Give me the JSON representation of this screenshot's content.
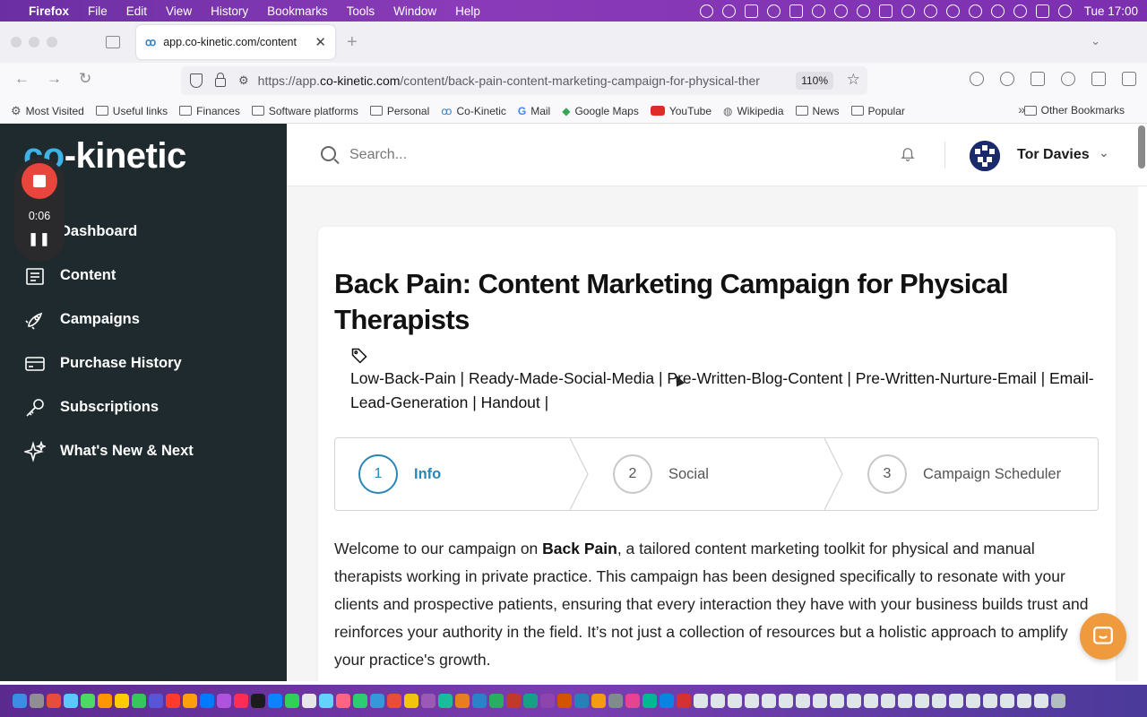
{
  "menubar": {
    "app_name": "Firefox",
    "items": [
      "File",
      "Edit",
      "View",
      "History",
      "Bookmarks",
      "Tools",
      "Window",
      "Help"
    ],
    "clock": "Tue  17:00"
  },
  "browser": {
    "tab_title": "app.co-kinetic.com/content",
    "url_prefix": "https://app.",
    "url_domain": "co-kinetic.com",
    "url_path": "/content/back-pain-content-marketing-campaign-for-physical-ther",
    "zoom": "110%",
    "bookmarks": [
      {
        "label": "Most Visited",
        "icon": "gear-icon"
      },
      {
        "label": "Useful links",
        "icon": "folder-icon"
      },
      {
        "label": "Finances",
        "icon": "folder-icon"
      },
      {
        "label": "Software platforms",
        "icon": "folder-icon"
      },
      {
        "label": "Personal",
        "icon": "folder-icon"
      },
      {
        "label": "Co-Kinetic",
        "icon": "cokinetic-icon"
      },
      {
        "label": "Mail",
        "icon": "google-icon"
      },
      {
        "label": "Google Maps",
        "icon": "maps-icon"
      },
      {
        "label": "YouTube",
        "icon": "youtube-icon"
      },
      {
        "label": "Wikipedia",
        "icon": "globe-icon"
      },
      {
        "label": "News",
        "icon": "folder-icon"
      },
      {
        "label": "Popular",
        "icon": "folder-icon"
      }
    ],
    "other_bookmarks": "Other Bookmarks"
  },
  "sidebar": {
    "logo_co": "co",
    "logo_rest": "-kinetic",
    "items": [
      {
        "label": "Dashboard",
        "icon": "dashboard-icon"
      },
      {
        "label": "Content",
        "icon": "content-icon"
      },
      {
        "label": "Campaigns",
        "icon": "rocket-icon"
      },
      {
        "label": "Purchase History",
        "icon": "credit-card-icon"
      },
      {
        "label": "Subscriptions",
        "icon": "key-icon"
      },
      {
        "label": "What's New & Next",
        "icon": "sparkle-icon"
      }
    ]
  },
  "recorder": {
    "time": "0:06",
    "pause_symbol": "❚❚"
  },
  "header": {
    "search_placeholder": "Search...",
    "user_name": "Tor Davies"
  },
  "content": {
    "title": "Back Pain: Content Marketing Campaign for Physical Therapists",
    "tags": "Low-Back-Pain | Ready-Made-Social-Media | Pre-Written-Blog-Content | Pre-Written-Nurture-Email | Email-Lead-Generation | Handout |",
    "steps": [
      {
        "number": "1",
        "label": "Info",
        "active": true
      },
      {
        "number": "2",
        "label": "Social",
        "active": false
      },
      {
        "number": "3",
        "label": "Campaign Scheduler",
        "active": false
      }
    ],
    "intro_before": "Welcome to our campaign on ",
    "intro_bold": "Back Pain",
    "intro_after": ", a tailored content marketing toolkit for physical and manual therapists working in private practice. This campaign has been designed specifically to resonate with your clients and prospective patients, ensuring that every interaction they have with your business builds trust and reinforces your authority in the field. It’s not just a collection of resources but a holistic approach to amplify your practice's growth."
  },
  "colors": {
    "sidebar_bg": "#1f2a2e",
    "accent": "#2a86b8",
    "logo_accent": "#3fb3e6",
    "chat_button": "#f09a3e",
    "record": "#e8453c"
  }
}
